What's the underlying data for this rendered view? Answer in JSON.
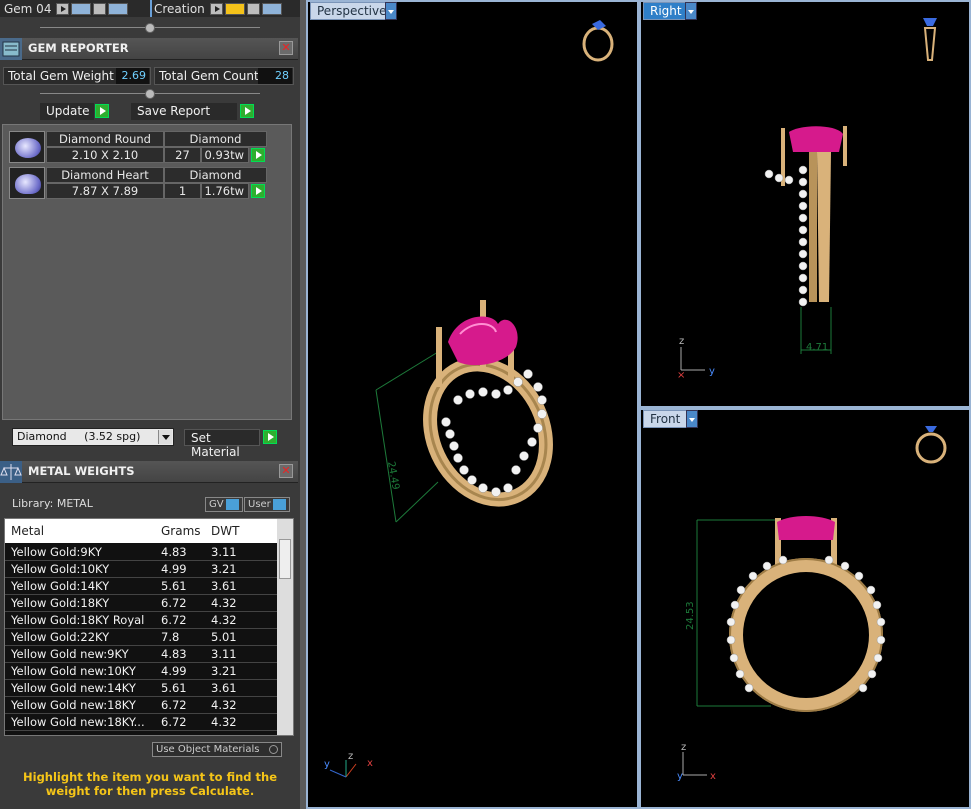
{
  "toolbar": {
    "gem_label": "Gem 04",
    "creation_label": "Creation"
  },
  "gem_reporter": {
    "title": "GEM REPORTER",
    "total_weight_label": "Total Gem Weight",
    "total_weight_value": "2.69",
    "total_count_label": "Total Gem Count",
    "total_count_value": "28",
    "update_label": "Update",
    "save_report_label": "Save Report",
    "gems": [
      {
        "shape": "Diamond Round",
        "material": "Diamond",
        "size": "2.10 X 2.10",
        "count": "27",
        "weight": "0.93tw"
      },
      {
        "shape": "Diamond Heart",
        "material": "Diamond",
        "size": "7.87 X 7.89",
        "count": "1",
        "weight": "1.76tw"
      }
    ],
    "material_select": "Diamond     (3.52 spg)",
    "set_material_label": "Set Material"
  },
  "metal_weights": {
    "title": "METAL WEIGHTS",
    "library_label": "Library: METAL",
    "gv_label": "GV",
    "user_label": "User",
    "columns": [
      "Metal",
      "Grams",
      "DWT"
    ],
    "rows": [
      [
        "Yellow Gold:9KY",
        "4.83",
        "3.11"
      ],
      [
        "Yellow Gold:10KY",
        "4.99",
        "3.21"
      ],
      [
        "Yellow Gold:14KY",
        "5.61",
        "3.61"
      ],
      [
        "Yellow Gold:18KY",
        "6.72",
        "4.32"
      ],
      [
        "Yellow Gold:18KY Royal",
        "6.72",
        "4.32"
      ],
      [
        "Yellow Gold:22KY",
        "7.8",
        "5.01"
      ],
      [
        "Yellow Gold new:9KY",
        "4.83",
        "3.11"
      ],
      [
        "Yellow Gold new:10KY",
        "4.99",
        "3.21"
      ],
      [
        "Yellow Gold new:14KY",
        "5.61",
        "3.61"
      ],
      [
        "Yellow Gold new:18KY",
        "6.72",
        "4.32"
      ],
      [
        "Yellow Gold new:18KY...",
        "6.72",
        "4.32"
      ]
    ],
    "use_object_materials_label": "Use Object Materials",
    "hint": "Highlight the item you want to find the weight for then press Calculate."
  },
  "viewports": {
    "perspective": {
      "label": "Perspective",
      "dimension": "24.49"
    },
    "right": {
      "label": "Right",
      "dimension": "4.71",
      "axis_v": "z",
      "axis_h": "y"
    },
    "front": {
      "label": "Front",
      "dimension": "24.53",
      "axis_v": "z",
      "axis_h": "x"
    }
  },
  "colors": {
    "gold": "#d9b27a",
    "gem": "#d61a8c",
    "dim_line": "#1d7a3a",
    "hint": "#f5c518",
    "accent": "#2f7fc8"
  }
}
